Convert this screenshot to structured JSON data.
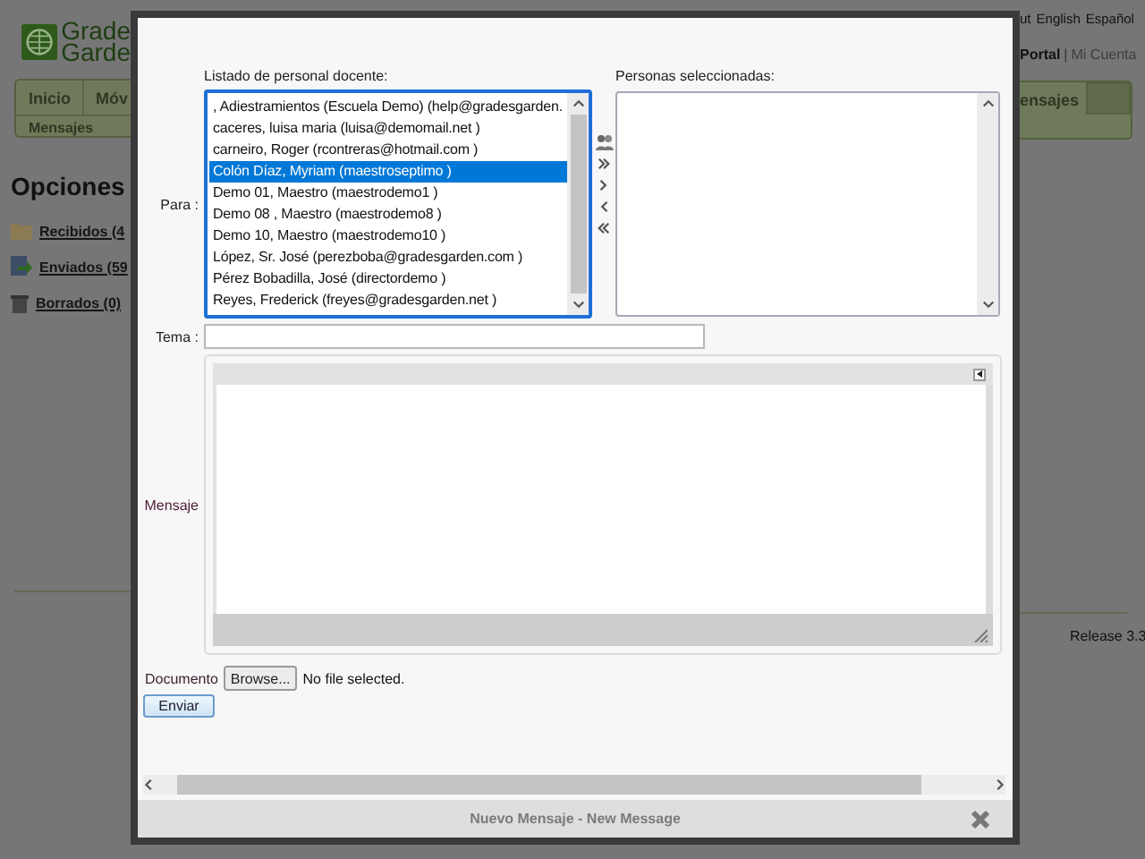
{
  "background": {
    "logo": {
      "line1": "Grade",
      "line2": "Garde"
    },
    "top_links": [
      "ut",
      "English",
      "Español"
    ],
    "account": {
      "portal": "Portal",
      "separator": "|",
      "account": "Mi Cuenta"
    },
    "tabs_left": [
      "Inicio",
      "Móv"
    ],
    "subtab": "Mensajes",
    "tabs_right": [
      "ensajes"
    ],
    "heading": "Opciones",
    "folders": [
      {
        "label": "Recibidos (4",
        "kind": "inbox"
      },
      {
        "label": "Enviados (59",
        "kind": "sent"
      },
      {
        "label": "Borrados (0)",
        "kind": "trash"
      }
    ],
    "release": "Release 3.3"
  },
  "dialog": {
    "title": "Nuevo Mensaje - New Message",
    "staff_list": {
      "label": "Listado de personal docente:",
      "items": [
        {
          "text": ", Adiestramientos (Escuela Demo) (help@gradesgarden.",
          "selected": false
        },
        {
          "text": "caceres, luisa maria (luisa@demomail.net )",
          "selected": false
        },
        {
          "text": "carneiro, Roger (rcontreras@hotmail.com )",
          "selected": false
        },
        {
          "text": "Colón Díaz, Myriam (maestroseptimo )",
          "selected": true
        },
        {
          "text": "Demo 01, Maestro (maestrodemo1 )",
          "selected": false
        },
        {
          "text": "Demo 08 , Maestro (maestrodemo8 )",
          "selected": false
        },
        {
          "text": "Demo 10, Maestro (maestrodemo10 )",
          "selected": false
        },
        {
          "text": "López, Sr. José (perezboba@gradesgarden.com )",
          "selected": false
        },
        {
          "text": "Pérez Bobadilla, José (directordemo )",
          "selected": false
        },
        {
          "text": "Reyes, Frederick (freyes@gradesgarden.net )",
          "selected": false
        }
      ]
    },
    "selected_list": {
      "label": "Personas seleccionadas:"
    },
    "to_label": "Para :",
    "subject": {
      "label": "Tema :"
    },
    "message": {
      "label": "Mensaje"
    },
    "document": {
      "label": "Documento",
      "button": "Browse...",
      "status": "No file selected."
    },
    "send_button": "Enviar"
  }
}
